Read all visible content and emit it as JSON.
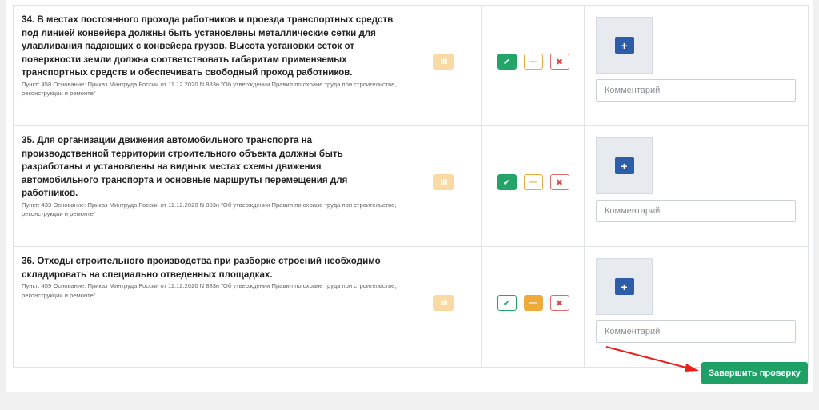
{
  "items": [
    {
      "title": "34. В местах постоянного прохода работников и проезда транспортных средств под линией конвейера должны быть установлены металлические сетки для улавливания падающих с конвейера грузов. Высота установки сеток от поверхности земли должна соответствовать габаритам применяемых транспортных средств и обеспечивать свободный проход работников.",
      "source": "Пункт: 458 Основание: Приказ Минтруда России от 11.12.2020 N 883н \"Об утверждении Правил по охране труда при строительстве, реконструкции и ремонте\"",
      "status": "yes"
    },
    {
      "title": "35. Для организации движения автомобильного транспорта на производственной территории строительного объекта должны быть разработаны и установлены на видных местах схемы движения автомобильного транспорта и основные маршруты перемещения для работников.",
      "source": "Пункт: 433 Основание: Приказ Минтруда России от 11.12.2020 N 883н \"Об утверждении Правил по охране труда при строительстве, реконструкции и ремонте\"",
      "status": "yes"
    },
    {
      "title": "36. Отходы строительного производства при разборке строений необходимо складировать на специально отведенных площадках.",
      "source": "Пункт: 459 Основание: Приказ Минтруда России от 11.12.2020 N 883н \"Об утверждении Правил по охране труда при строительстве, реконструкции и ремонте\"",
      "status": "partial"
    }
  ],
  "icons": {
    "badge": "bars-icon",
    "yes": "check-icon",
    "partial": "minus-icon",
    "no": "cross-icon",
    "upload": "plus-icon"
  },
  "comment_placeholder": "Комментарий",
  "finish_label": "Завершить проверку",
  "colors": {
    "green": "#22a566",
    "orange": "#eeab3c",
    "red": "#e04848",
    "blue": "#2d5da6",
    "annotation_arrow": "#e8201c"
  }
}
